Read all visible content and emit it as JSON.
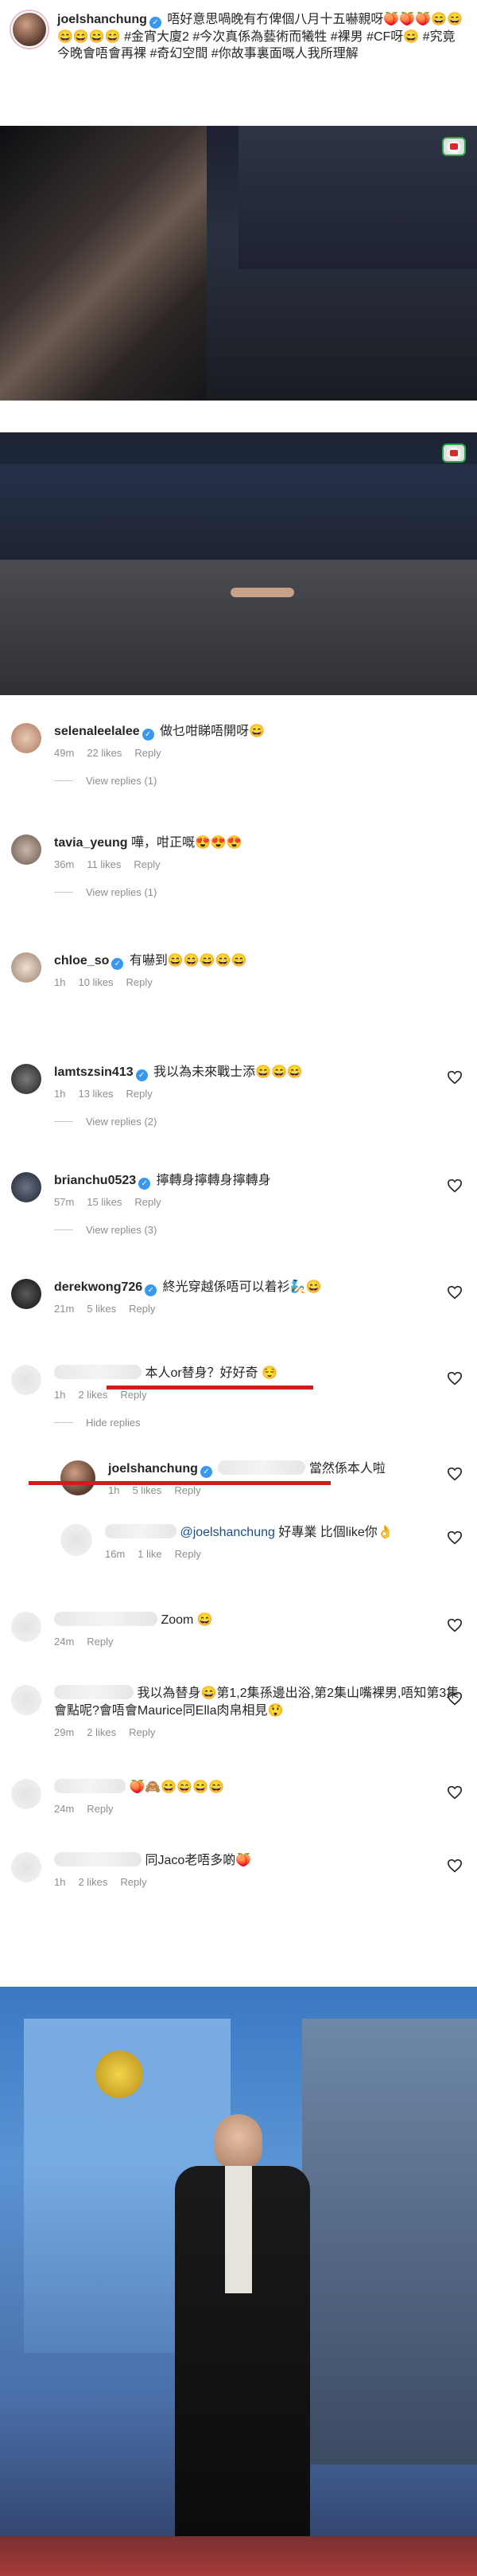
{
  "post": {
    "username": "joelshanchung",
    "caption": "唔好意思喎晚有冇俾個八月十五嚇親呀🍑🍑🍑😄😄😄😄😄😄 #金宵大廈2 #今次真係為藝術而犧牲 #裸男 #CF呀😄 #究竟今晚會唔會再裸 #奇幻空間 #你故事裏面嘅人我所理解"
  },
  "comments": [
    {
      "username": "selenaleelalee",
      "verified": true,
      "text": "做乜咁睇唔開呀😄",
      "time": "49m",
      "likes": "22 likes",
      "reply": "Reply",
      "view_replies": "View replies (1)"
    },
    {
      "username": "tavia_yeung",
      "verified": false,
      "text": "嘩，咁正嘅😍😍😍",
      "time": "36m",
      "likes": "11 likes",
      "reply": "Reply",
      "view_replies": "View replies (1)"
    },
    {
      "username": "chloe_so",
      "verified": true,
      "text": "有嚇到😄😄😄😄😄",
      "time": "1h",
      "likes": "10 likes",
      "reply": "Reply"
    },
    {
      "username": "lamtszsin413",
      "verified": true,
      "text": "我以為未來戰士添😄😄😄",
      "time": "1h",
      "likes": "13 likes",
      "reply": "Reply",
      "view_replies": "View replies (2)"
    },
    {
      "username": "brianchu0523",
      "verified": true,
      "text": "擰轉身擰轉身擰轉身",
      "time": "57m",
      "likes": "15 likes",
      "reply": "Reply",
      "view_replies": "View replies (3)"
    },
    {
      "username": "derekwong726",
      "verified": true,
      "text": "終光穿越係唔可以着衫🧞😄",
      "time": "21m",
      "likes": "5 likes",
      "reply": "Reply"
    }
  ],
  "anon_comments": [
    {
      "text": "本人or替身？好好奇 😌",
      "time": "1h",
      "likes": "2 likes",
      "reply": "Reply",
      "hide_replies": "Hide replies"
    },
    {
      "text": "Zoom 😄",
      "time": "24m",
      "reply": "Reply"
    },
    {
      "text": "我以為替身😄第1,2集孫邊出浴,第2集山嘴裸男,唔知第3集會點呢?會唔會Maurice同Ella肉帛相見😲",
      "time": "29m",
      "likes": "2 likes",
      "reply": "Reply"
    },
    {
      "text": "🍑🙈😄😄😄😄",
      "time": "24m",
      "reply": "Reply"
    },
    {
      "text": "同Jaco老唔多啲🍑",
      "time": "1h",
      "likes": "2 likes",
      "reply": "Reply"
    }
  ],
  "replies": [
    {
      "username": "joelshanchung",
      "text": "當然係本人啦",
      "time": "1h",
      "likes": "5 likes",
      "reply": "Reply"
    },
    {
      "mention": "@joelshanchung",
      "text": "好專業 比個like你👌",
      "time": "16m",
      "likes": "1 like",
      "reply": "Reply"
    }
  ],
  "icons": [
    "heart-icon",
    "verified-badge-icon",
    "tvb-logo-icon"
  ],
  "colors": {
    "verified": "#3897f0",
    "meta": "#8e8e8e",
    "hashtag": "#1a4f8b",
    "highlight": "#d01c1c"
  }
}
